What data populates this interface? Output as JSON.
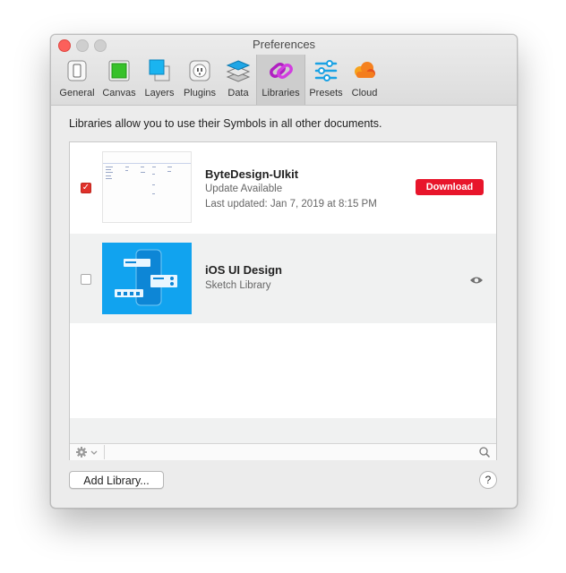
{
  "window": {
    "title": "Preferences"
  },
  "toolbar": {
    "items": [
      {
        "label": "General",
        "icon": "general-icon"
      },
      {
        "label": "Canvas",
        "icon": "canvas-icon"
      },
      {
        "label": "Layers",
        "icon": "layers-icon"
      },
      {
        "label": "Plugins",
        "icon": "plugins-icon"
      },
      {
        "label": "Data",
        "icon": "data-icon"
      },
      {
        "label": "Libraries",
        "icon": "libraries-icon",
        "active": true
      },
      {
        "label": "Presets",
        "icon": "presets-icon"
      },
      {
        "label": "Cloud",
        "icon": "cloud-icon"
      }
    ]
  },
  "content": {
    "description": "Libraries allow you to use their Symbols in all other documents."
  },
  "libraries": [
    {
      "name": "ByteDesign-UIkit",
      "status": "Update Available",
      "updated": "Last updated: Jan 7, 2019 at 8:15 PM",
      "checked": true,
      "action_label": "Download"
    },
    {
      "name": "iOS UI Design",
      "status": "Sketch Library",
      "checked": false,
      "action_icon": "eye-icon"
    }
  ],
  "footer": {
    "add_library_label": "Add Library...",
    "help_label": "?"
  },
  "colors": {
    "accent_red": "#e8152b",
    "thumb_blue": "#11a3ef"
  }
}
